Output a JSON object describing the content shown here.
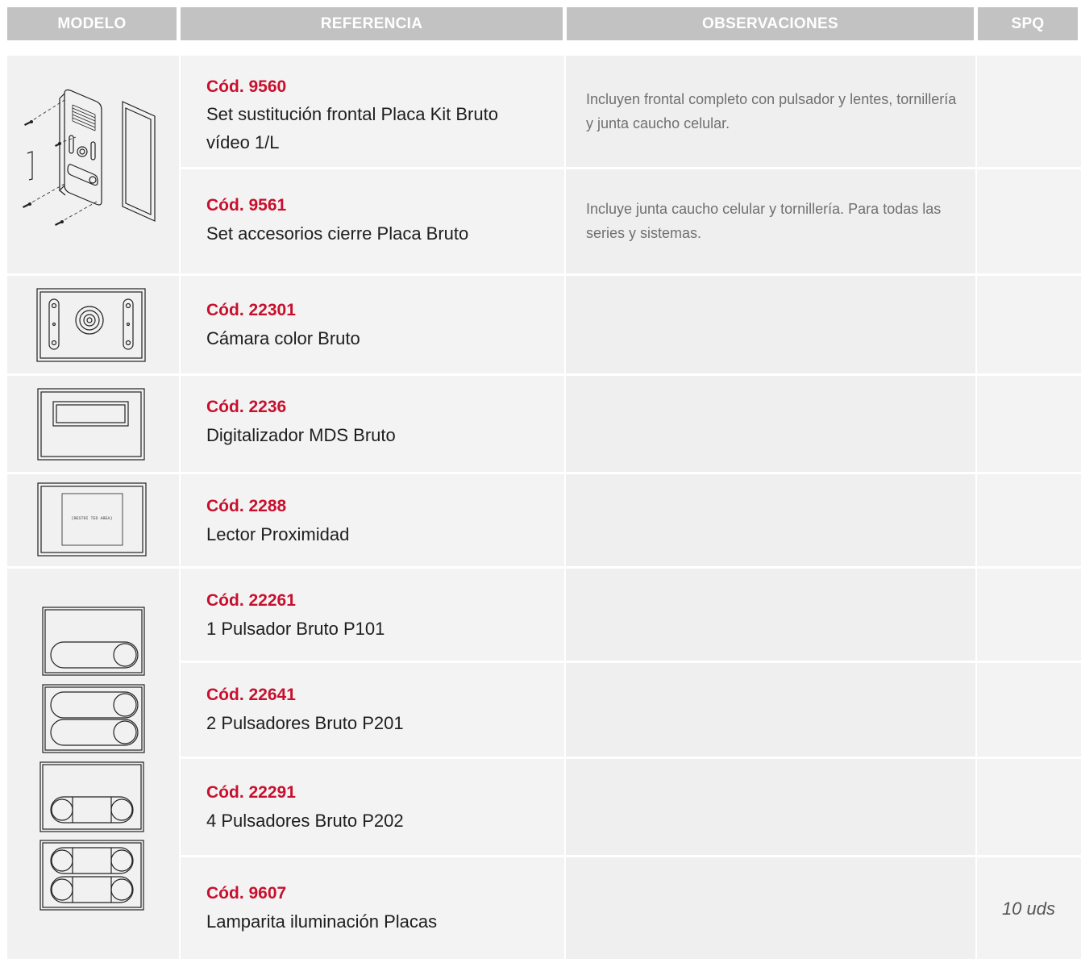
{
  "headers": {
    "modelo": "MODELO",
    "referencia": "REFERENCIA",
    "observaciones": "OBSERVACIONES",
    "spq": "SPQ"
  },
  "rows": [
    {
      "code": "Cód. 9560",
      "desc": "Set sustitución frontal Placa Kit Bruto vídeo 1/L",
      "obs": "Incluyen frontal completo con pulsador y lentes, tornillería y junta caucho celular.",
      "spq": ""
    },
    {
      "code": "Cód. 9561",
      "desc": "Set accesorios cierre Placa Bruto",
      "obs": "Incluye junta caucho celular y tornillería.  Para todas las series y sistemas.",
      "spq": ""
    },
    {
      "code": "Cód. 22301",
      "desc": "Cámara color Bruto",
      "obs": "",
      "spq": ""
    },
    {
      "code": "Cód. 2236",
      "desc": "Digitalizador MDS Bruto",
      "obs": "",
      "spq": ""
    },
    {
      "code": "Cód. 2288",
      "desc": "Lector Proximidad",
      "obs": "",
      "spq": ""
    },
    {
      "code": "Cód. 22261",
      "desc": "1 Pulsador Bruto P101",
      "obs": "",
      "spq": ""
    },
    {
      "code": "Cód. 22641",
      "desc": "2 Pulsadores Bruto P201",
      "obs": "",
      "spq": ""
    },
    {
      "code": "Cód. 22291",
      "desc": "4 Pulsadores Bruto P202",
      "obs": "",
      "spq": ""
    },
    {
      "code": "Cód. 9607",
      "desc": "Lamparita iluminación Placas",
      "obs": "",
      "spq": "10 uds"
    }
  ],
  "images": {
    "proximity_label": "(RESTRI TED AREA)"
  },
  "colors": {
    "header_bg": "#c2c2c2",
    "code_red": "#c8102e",
    "row_bg": "#f3f3f3"
  }
}
